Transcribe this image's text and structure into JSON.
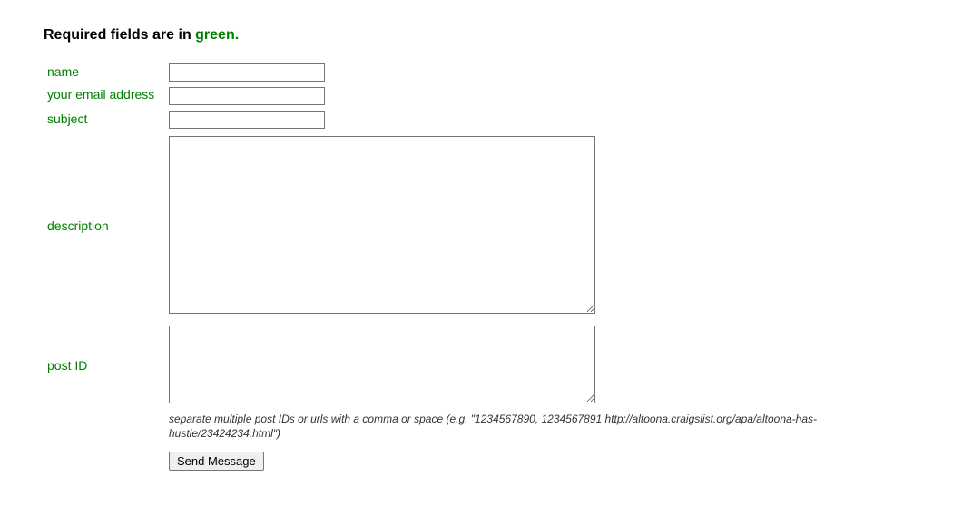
{
  "heading": {
    "prefix": "Required fields are in ",
    "highlight": "green.",
    "suffix": ""
  },
  "fields": {
    "name": {
      "label": "name",
      "value": ""
    },
    "email": {
      "label": "your email address",
      "value": ""
    },
    "subject": {
      "label": "subject",
      "value": ""
    },
    "description": {
      "label": "description",
      "value": ""
    },
    "postid": {
      "label": "post ID",
      "value": ""
    }
  },
  "hint": "separate multiple post IDs or urls with a comma or space (e.g. \"1234567890, 1234567891 http://altoona.craigslist.org/apa/altoona-has-hustle/23424234.html\")",
  "buttons": {
    "submit": "Send Message"
  }
}
